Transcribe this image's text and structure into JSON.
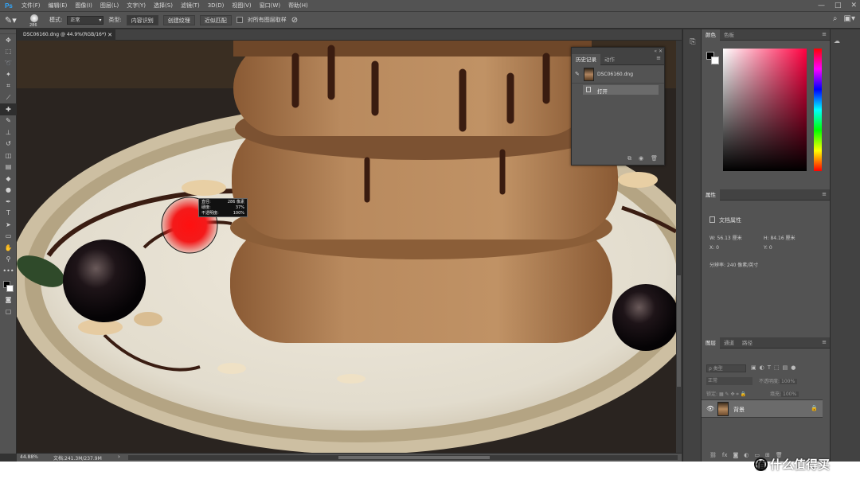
{
  "app": {
    "logo": "Ps"
  },
  "menubar": {
    "items": [
      "文件(F)",
      "编辑(E)",
      "图像(I)",
      "图层(L)",
      "文字(Y)",
      "选择(S)",
      "滤镜(T)",
      "3D(D)",
      "视图(V)",
      "窗口(W)",
      "帮助(H)"
    ],
    "window_controls": [
      "—",
      "□",
      "✕"
    ]
  },
  "options": {
    "brush_size": "286",
    "mode_label": "模式:",
    "mode_value": "正常",
    "type_label": "类型:",
    "type_buttons": [
      "内容识别",
      "创建纹理",
      "近似匹配"
    ],
    "sample_all_label": "对所有图层取样"
  },
  "document": {
    "tab_title": "DSC06160.dng @ 44.9%(RGB/16*)",
    "zoom": "44.88%",
    "doc_info": "文档:241.3M/237.9M"
  },
  "brush_tooltip": {
    "rows": [
      {
        "label": "直径:",
        "value": "286 像素"
      },
      {
        "label": "硬度:",
        "value": "37%"
      },
      {
        "label": "不透明度:",
        "value": "100%"
      }
    ]
  },
  "history_panel": {
    "tabs": [
      "历史记录",
      "动作"
    ],
    "snapshot_name": "DSC06160.dng",
    "steps": [
      "打开"
    ]
  },
  "color_panel": {
    "tabs": [
      "颜色",
      "色板"
    ],
    "hue_accent": "#ff0040"
  },
  "properties_panel": {
    "tab": "属性",
    "doc_title": "文档属性",
    "w_label": "W:",
    "w_value": "56.13 厘米",
    "h_label": "H:",
    "h_value": "84.16 厘米",
    "x_label": "X:",
    "x_value": "0",
    "y_label": "Y:",
    "y_value": "0",
    "resolution": "分辨率: 240 像素/英寸"
  },
  "layers_panel": {
    "tabs": [
      "图层",
      "通道",
      "路径"
    ],
    "filter_placeholder": "ρ 类型",
    "blend_mode": "正常",
    "opacity_label": "不透明度:",
    "opacity_value": "100%",
    "lock_label": "锁定:",
    "fill_label": "填充:",
    "fill_value": "100%",
    "layers": [
      {
        "name": "背景"
      }
    ]
  },
  "watermark": {
    "text": "什么值得买",
    "badge": "值"
  }
}
